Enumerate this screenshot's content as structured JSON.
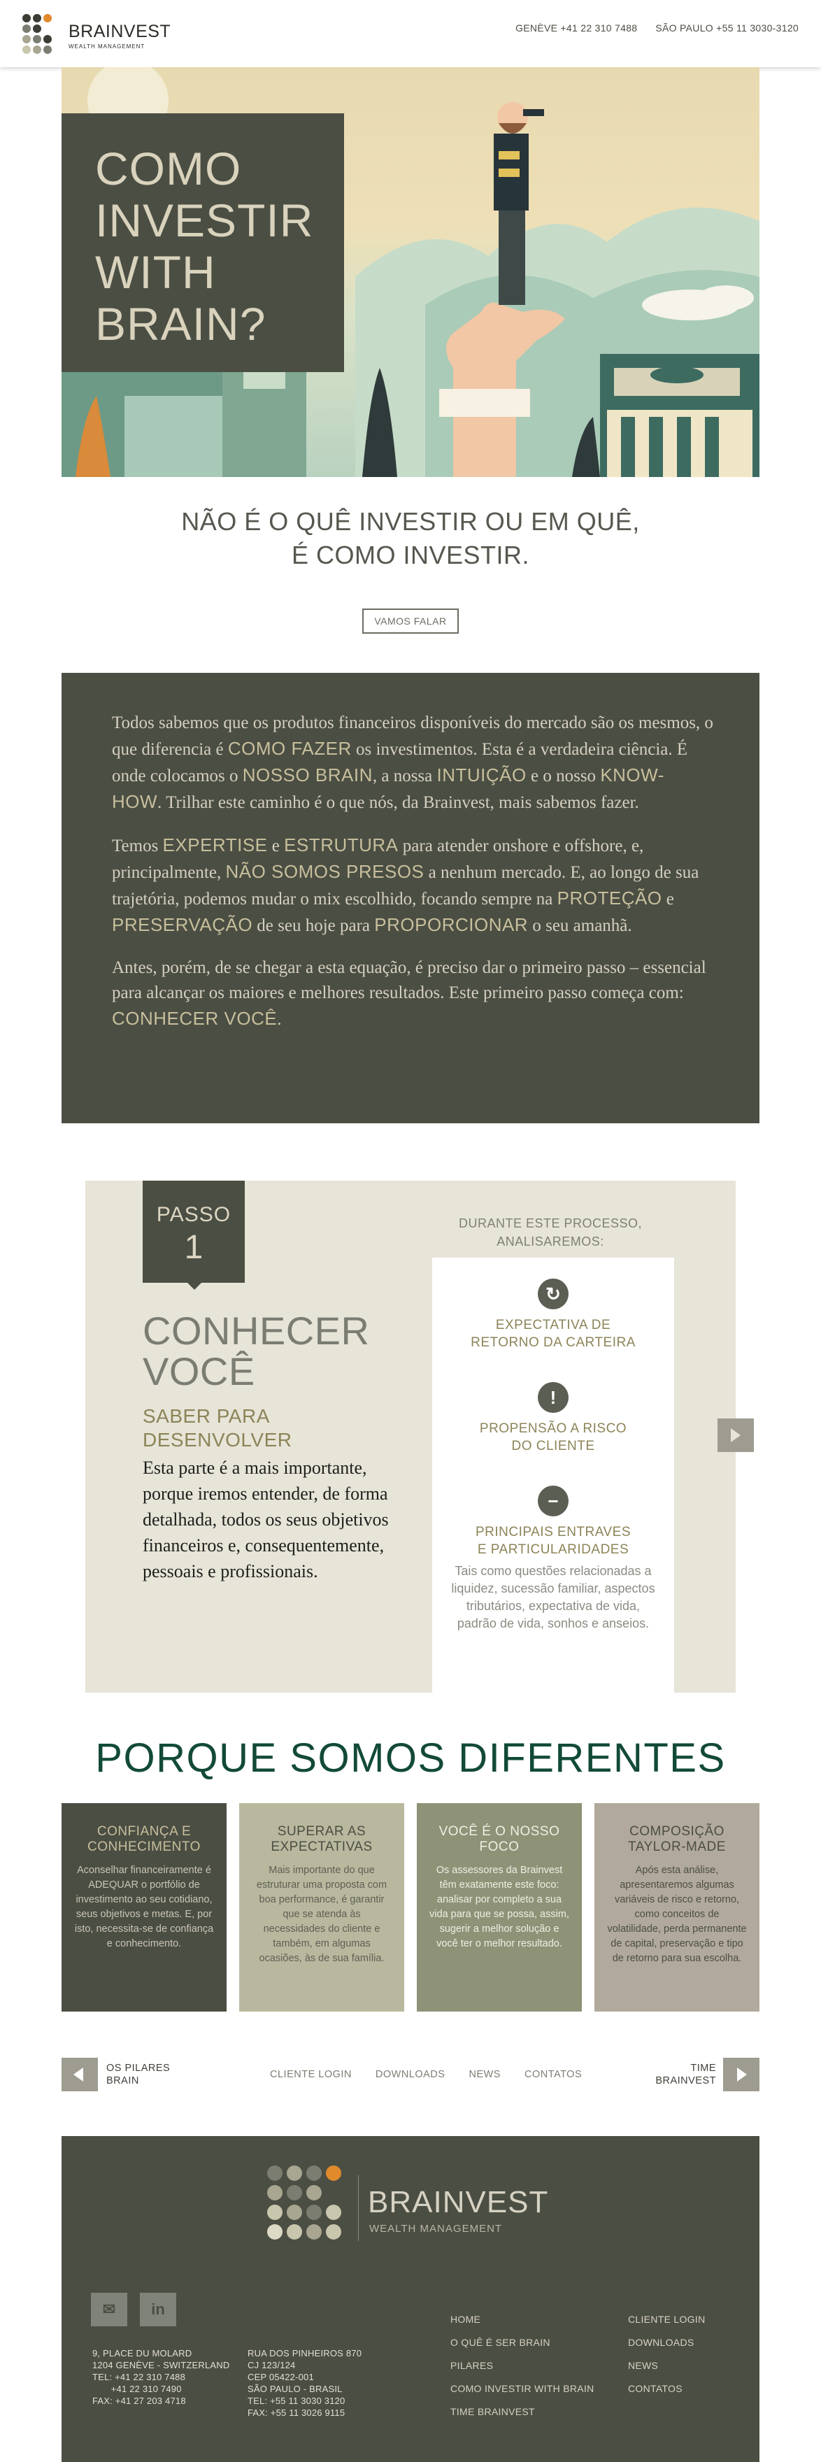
{
  "header": {
    "brand_name": "BRAINVEST",
    "brand_sub": "WEALTH MANAGEMENT",
    "phone_geneve": "GENÈVE +41 22 310 7488",
    "phone_saopaulo": "SÃO PAULO +55 11 3030-3120"
  },
  "hero": {
    "title": "COMO\nINVESTIR\nWITH\nBRAIN?"
  },
  "intro": {
    "line1": "NÃO É O QUÊ INVESTIR OU EM QUÊ,",
    "line2": "É COMO INVESTIR.",
    "cta": "VAMOS FALAR"
  },
  "textblock": {
    "p1": {
      "a": "Todos sabemos que os produtos financeiros disponíveis do mercado são os mesmos, o que diferencia é ",
      "b": "COMO FAZER",
      "c": " os investimentos. Esta é a verdadeira ciência. É onde colocamos o ",
      "d": "NOSSO BRAIN",
      "e": ", a nossa ",
      "f": "INTUIÇÃO",
      "g": " e o nosso ",
      "h": "KNOW-HOW",
      "i": ". Trilhar este caminho é o que nós, da Brainvest, mais sabemos fazer."
    },
    "p2": {
      "a": "Temos ",
      "b": "EXPERTISE",
      "c": " e ",
      "d": "ESTRUTURA",
      "e": " para atender onshore e offshore, e, principalmente, ",
      "f": "NÃO SOMOS PRESOS",
      "g": " a nenhum mercado. E, ao longo de sua trajetória, podemos mudar o mix escolhido, focando sempre na ",
      "h": "PROTEÇÃO",
      "i": " e ",
      "j": "PRESERVAÇÃO",
      "k": " de seu hoje para ",
      "l": "PROPORCIONAR",
      "m": " o seu amanhã."
    },
    "p3": {
      "a": "Antes, porém, de se chegar a esta equação, é preciso dar o primeiro passo – essencial para alcançar os maiores e melhores resultados. Este primeiro passo começa com: ",
      "b": "CONHECER VOCÊ",
      "c": "."
    }
  },
  "step": {
    "label": "PASSO",
    "number": "1",
    "title_l1": "CONHECER",
    "title_l2": "VOCÊ",
    "sub_l1": "SABER PARA",
    "sub_l2": "DESENVOLVER",
    "body": "Esta parte é a mais importante, porque iremos entender, de forma detalhada, todos os seus objetivos financeiros e, consequentemente, pessoais e profissionais.",
    "during_l1": "DURANTE ESTE PROCESSO,",
    "during_l2": "ANALISAREMOS:",
    "features": [
      {
        "icon": "refresh-icon",
        "title_l1": "EXPECTATIVA DE",
        "title_l2": "RETORNO DA CARTEIRA",
        "desc": ""
      },
      {
        "icon": "exclamation-icon",
        "title_l1": "PROPENSÃO A RISCO",
        "title_l2": "DO CLIENTE",
        "desc": ""
      },
      {
        "icon": "minus-icon",
        "title_l1": "PRINCIPAIS ENTRAVES",
        "title_l2": "E PARTICULARIDADES",
        "desc": "Tais como questões relacionadas a liquidez, sucessão familiar, aspectos tributários, expectativa de vida, padrão de vida, sonhos e anseios."
      }
    ]
  },
  "diferentes": {
    "title": "PORQUE SOMOS DIFERENTES",
    "cards": [
      {
        "title": "CONFIANÇA E CONHECIMENTO",
        "desc": "Aconselhar financeiramente é ADEQUAR o portfólio de investimento ao seu cotidiano, seus objetivos e metas. E, por isto, necessita-se de confiança e conhecimento.",
        "bg": "#4b4e43",
        "title_color": "#c7bf9c",
        "desc_color": "#c9c6b6"
      },
      {
        "title": "SUPERAR AS EXPECTATIVAS",
        "desc": "Mais importante do que estruturar uma proposta com boa performance, é garantir que se atenda às necessidades do cliente e também, em algumas ocasiões, às de sua família.",
        "bg": "#b9b89e",
        "title_color": "#4b4e43",
        "desc_color": "#5d5f54"
      },
      {
        "title": "VOCÊ É O NOSSO FOCO",
        "desc": "Os assessores da Brainvest têm exatamente este foco: analisar por completo a sua vida para que se possa, assim, sugerir a melhor solução e você ter o melhor resultado.",
        "bg": "#8e9378",
        "title_color": "#f0eee2",
        "desc_color": "#f0eee2"
      },
      {
        "title": "COMPOSIÇÃO TAYLOR-MADE",
        "desc": "Após esta análise, apresentaremos algumas variáveis de risco e retorno, como conceitos de volatilidade, perda permanente de capital, preservação e tipo de retorno para sua escolha.",
        "bg": "#b1a99b",
        "title_color": "#4b4e43",
        "desc_color": "#4b4e43"
      }
    ]
  },
  "nav": {
    "prev_l1": "OS PILARES",
    "prev_l2": "BRAIN",
    "next_l1": "TIME",
    "next_l2": "BRAINVEST",
    "links": [
      "CLIENTE LOGIN",
      "DOWNLOADS",
      "NEWS",
      "CONTATOS"
    ]
  },
  "footer": {
    "brand": "BRAINVEST",
    "brand_sub": "WEALTH MANAGEMENT",
    "addr_geneve": [
      "9, PLACE DU MOLARD",
      "1204 GENÈVE - SWITZERLAND",
      "TEL: +41 22 310 7488",
      "       +41 22 310 7490",
      "FAX: +41 27 203 4718"
    ],
    "addr_sp": [
      "RUA DOS PINHEIROS 870",
      "CJ 123/124",
      "CEP 05422-001",
      "SÃO PAULO - BRASIL",
      "TEL: +55 11 3030 3120",
      "FAX: +55 11 3026 9115"
    ],
    "links_col1": [
      "HOME",
      "O QUÊ É SER BRAIN",
      "PILARES",
      "COMO INVESTIR WITH BRAIN",
      "TIME BRAINVEST"
    ],
    "links_col2": [
      "CLIENTE LOGIN",
      "DOWNLOADS",
      "NEWS",
      "CONTATOS"
    ],
    "social": [
      "email-icon",
      "linkedin-icon"
    ]
  },
  "colors": {
    "dark": "#4b4e43",
    "accent_gold": "#c7bf9c",
    "orange": "#e08a2c",
    "title_green": "#124a36"
  }
}
